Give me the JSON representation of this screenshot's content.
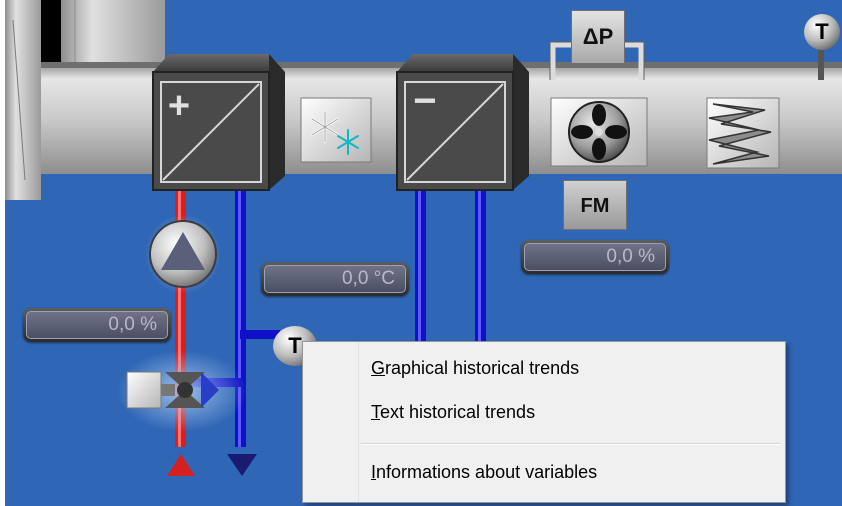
{
  "process": {
    "heater_sign": "+",
    "cooler_sign": "−",
    "dp_label": "ΔP",
    "fm_label": "FM",
    "temp_sensor_label": "T",
    "heater_valve_readout": "0,0 %",
    "supply_temp_readout": "0,0 °C",
    "fan_readout": "0,0 %"
  },
  "context_menu": {
    "items": [
      {
        "prefix": "G",
        "rest": "raphical historical trends"
      },
      {
        "prefix": "T",
        "rest": "ext historical trends"
      },
      {
        "prefix": "I",
        "rest": "nformations about variables"
      }
    ]
  },
  "colors": {
    "background": "#2f66b5",
    "hot_water": "#d42020",
    "cold_water": "#1010c8",
    "duct": "#c4c4c4"
  }
}
